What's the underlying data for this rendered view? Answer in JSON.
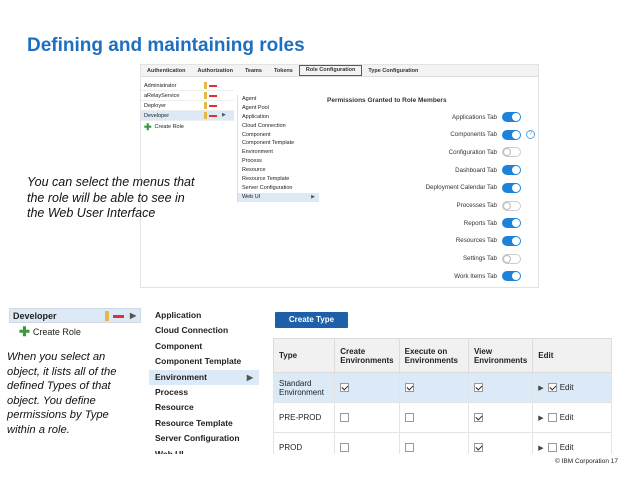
{
  "slide_title": "Defining and maintaining roles",
  "top": {
    "tabs": [
      "Authentication",
      "Authorization",
      "Teams",
      "Tokens",
      "Role Configuration",
      "Type Configuration"
    ],
    "selected_tab": "Role Configuration",
    "roles": [
      "Administrator",
      "aRelayService",
      "Deployer",
      "Developer"
    ],
    "selected_role": "Developer",
    "create_role": "Create Role",
    "types": [
      "Agent",
      "Agent Pool",
      "Application",
      "Cloud Connection",
      "Component",
      "Component Template",
      "Environment",
      "Process",
      "Resource",
      "Resource Template",
      "Server Configuration",
      "Web UI"
    ],
    "selected_type": "Web UI",
    "permissions_title": "Permissions Granted to Role Members",
    "permissions": [
      {
        "label": "Applications Tab",
        "on": true
      },
      {
        "label": "Components Tab",
        "on": true
      },
      {
        "label": "Configuration Tab",
        "on": false
      },
      {
        "label": "Dashboard Tab",
        "on": true
      },
      {
        "label": "Deployment Calendar Tab",
        "on": true
      },
      {
        "label": "Processes Tab",
        "on": false
      },
      {
        "label": "Reports Tab",
        "on": true
      },
      {
        "label": "Resources Tab",
        "on": true
      },
      {
        "label": "Settings Tab",
        "on": false
      },
      {
        "label": "Work Items Tab",
        "on": true
      }
    ],
    "help_icon": "?"
  },
  "callout1": "You can select the menus that the role will be able to see in the Web User Interface",
  "bottom": {
    "role": "Developer",
    "create_role": "Create Role",
    "types": [
      "Application",
      "Cloud Connection",
      "Component",
      "Component Template",
      "Environment",
      "Process",
      "Resource",
      "Resource Template",
      "Server Configuration",
      "Web UI"
    ],
    "selected_type": "Environment",
    "create_type_button": "Create Type",
    "table": {
      "headers": [
        "Type",
        "Create Environments",
        "Execute on Environments",
        "View Environments",
        "Edit"
      ],
      "rows": [
        {
          "type": "Standard Environment",
          "create": true,
          "execute": true,
          "view": true,
          "edit": true,
          "edit_label": "Edit",
          "selected": true
        },
        {
          "type": "PRE-PROD",
          "create": false,
          "execute": false,
          "view": true,
          "edit": false,
          "edit_label": "Edit",
          "selected": false
        },
        {
          "type": "PROD",
          "create": false,
          "execute": false,
          "view": true,
          "edit": false,
          "edit_label": "Edit",
          "selected": false
        }
      ]
    }
  },
  "callout2": "When you select an object, it lists all of the defined Types of that object. You define permissions by Type within a role.",
  "footer": "© IBM Corporation 17",
  "colors": {
    "title": "#1f6fc0",
    "toggle_on": "#1d82d9",
    "selection": "#dce9f6",
    "button": "#1d5fa8",
    "highlight_border": "#d0252a"
  }
}
